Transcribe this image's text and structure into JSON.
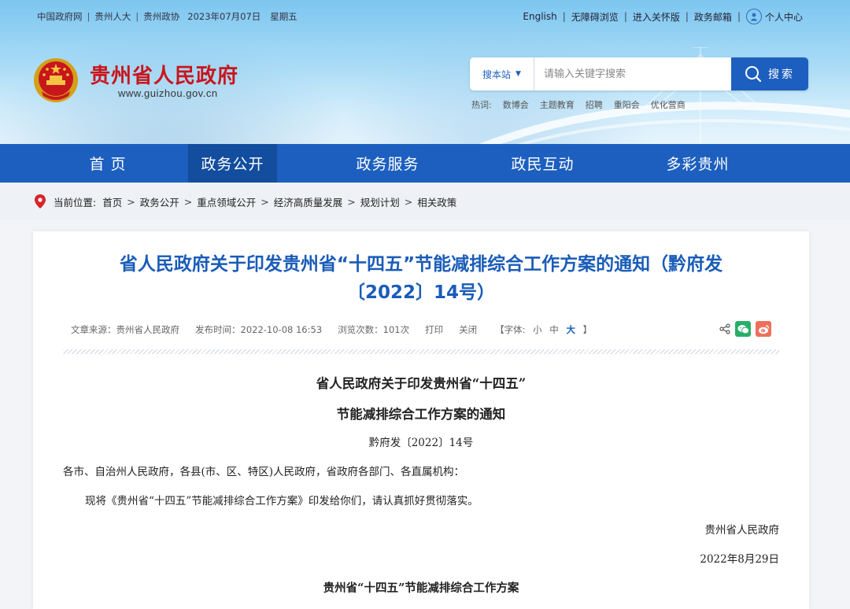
{
  "topbar": {
    "links": [
      "中国政府网",
      "贵州人大",
      "贵州政协"
    ],
    "date": "2023年07月07日",
    "weekday": "星期五"
  },
  "toplinks": {
    "english": "English",
    "accessible": "无障碍浏览",
    "care_mode": "进入关怀版",
    "mail": "政务邮箱",
    "personal": "个人中心"
  },
  "site": {
    "name": "贵州省人民政府",
    "url": "www.guizhou.gov.cn"
  },
  "search": {
    "scope": "搜本站",
    "placeholder": "请输入关键字搜索",
    "button": "搜索",
    "hot_label": "热词:",
    "hot_words": [
      "数博会",
      "主题教育",
      "招聘",
      "重阳会",
      "优化营商"
    ]
  },
  "nav": {
    "items": [
      "首页",
      "政务公开",
      "政务服务",
      "政民互动",
      "多彩贵州"
    ],
    "active_index": 1
  },
  "breadcrumb": {
    "label": "当前位置:",
    "items": [
      "首页",
      "政务公开",
      "重点领域公开",
      "经济高质量发展",
      "规划计划",
      "相关政策"
    ]
  },
  "article": {
    "title_line1": "省人民政府关于印发贵州省“十四五”节能减排综合工作方案的通知（黔府发",
    "title_line2": "〔2022〕14号）",
    "source_label": "文章来源：",
    "source": "贵州省人民政府",
    "time_label": "发布时间：",
    "time": "2022-10-08 16:53",
    "views_label": "浏览次数：",
    "views": "101次",
    "print": "打印",
    "close": "关闭",
    "font_label": "【字体:",
    "font_small": "小",
    "font_medium": "中",
    "font_large": "大",
    "font_end": "】"
  },
  "doc": {
    "heading1": "省人民政府关于印发贵州省“十四五”",
    "heading2": "节能减排综合工作方案的通知",
    "doc_no": "黔府发〔2022〕14号",
    "recipients": "各市、自治州人民政府，各县(市、区、特区)人民政府，省政府各部门、各直属机构：",
    "body": "现将《贵州省“十四五”节能减排综合工作方案》印发给你们，请认真抓好贯彻落实。",
    "signature": "贵州省人民政府",
    "date": "2022年8月29日",
    "heading3": "贵州省“十四五”节能减排综合工作方案"
  },
  "colors": {
    "primary": "#1d5fbf",
    "title_red": "#c8161d",
    "title_blue": "#1a5cb8"
  }
}
